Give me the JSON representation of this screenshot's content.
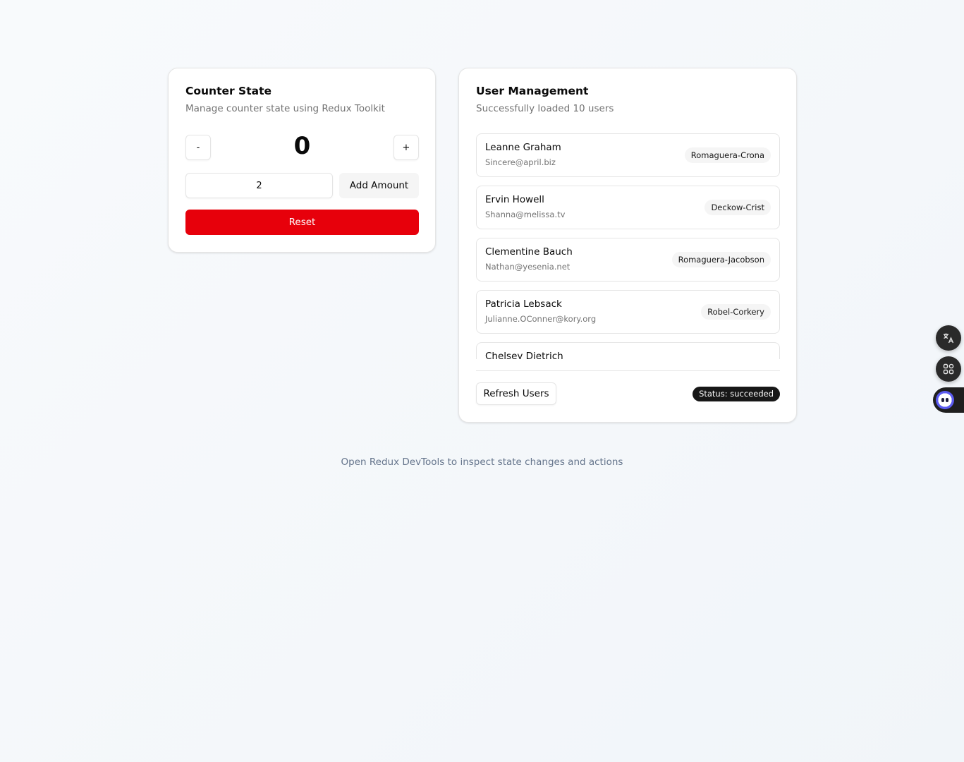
{
  "counter": {
    "title": "Counter State",
    "description": "Manage counter state using Redux Toolkit",
    "decrement_label": "-",
    "increment_label": "+",
    "value": "0",
    "amount_value": "2",
    "add_amount_label": "Add Amount",
    "reset_label": "Reset",
    "colors": {
      "reset": "#e7000b"
    }
  },
  "users": {
    "title": "User Management",
    "description": "Successfully loaded 10 users",
    "items": [
      {
        "name": "Leanne Graham",
        "email": "Sincere@april.biz",
        "company": "Romaguera-Crona"
      },
      {
        "name": "Ervin Howell",
        "email": "Shanna@melissa.tv",
        "company": "Deckow-Crist"
      },
      {
        "name": "Clementine Bauch",
        "email": "Nathan@yesenia.net",
        "company": "Romaguera-Jacobson"
      },
      {
        "name": "Patricia Lebsack",
        "email": "Julianne.OConner@kory.org",
        "company": "Robel-Corkery"
      },
      {
        "name": "Chelsey Dietrich",
        "email": "",
        "company": ""
      }
    ],
    "refresh_label": "Refresh Users",
    "status_label": "Status: succeeded"
  },
  "footer_note": "Open Redux DevTools to inspect state changes and actions",
  "side_widgets": [
    "translate-icon",
    "apps-grid-icon",
    "assistant-bot-icon"
  ]
}
